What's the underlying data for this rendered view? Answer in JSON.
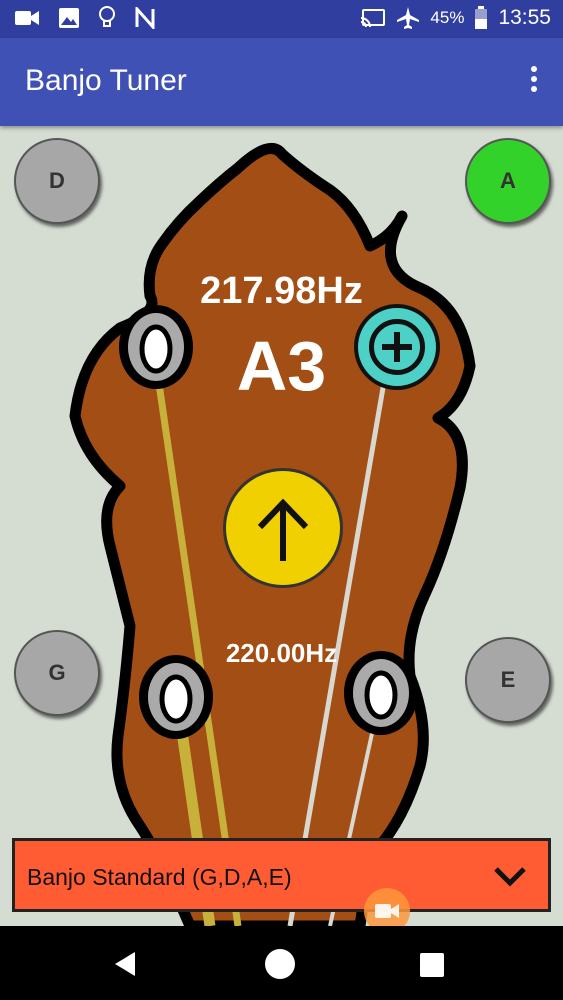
{
  "status_bar": {
    "battery_percent": "45%",
    "time": "13:55",
    "icons": [
      "video-icon",
      "image-icon",
      "bulb-icon",
      "n-icon",
      "cast-icon",
      "airplane-icon",
      "battery-icon"
    ]
  },
  "app_bar": {
    "title": "Banjo Tuner",
    "menu_icon": "more-vert-icon"
  },
  "tuner": {
    "detected_frequency": "217.98Hz",
    "detected_note": "A3",
    "target_frequency": "220.00Hz",
    "direction": "up",
    "strings": [
      {
        "label": "D",
        "selected": false
      },
      {
        "label": "A",
        "selected": true
      },
      {
        "label": "G",
        "selected": false
      },
      {
        "label": "E",
        "selected": false
      }
    ]
  },
  "tuning_dropdown": {
    "selected": "Banjo Standard (G,D,A,E)"
  },
  "nav": [
    "back-icon",
    "home-icon",
    "recents-icon"
  ],
  "colors": {
    "status_bar": "#303f9f",
    "app_bar": "#3f51b5",
    "headstock": "#a24e14",
    "selected_string": "#33d22a",
    "indicator": "#f0d000",
    "add_button": "#4dd0c6",
    "dropdown": "#ff5c33"
  }
}
